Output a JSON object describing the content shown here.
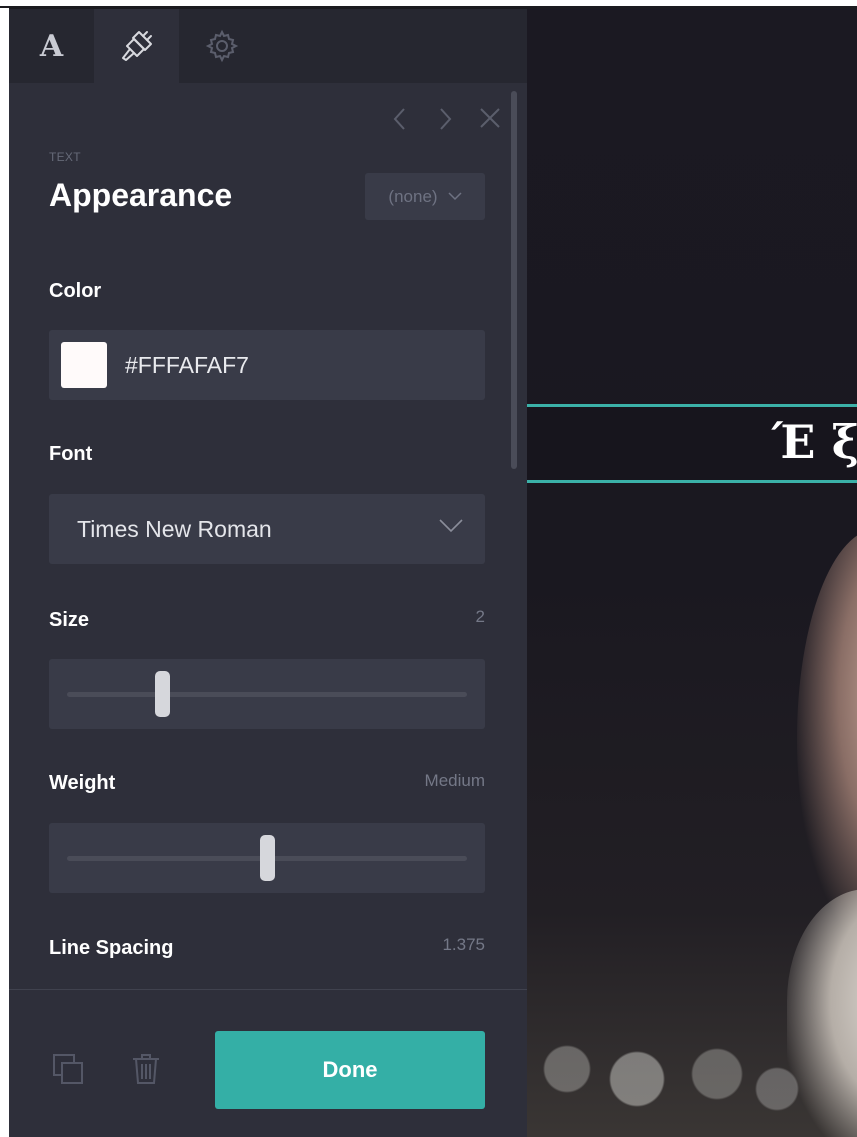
{
  "tabs": [
    {
      "name": "text-tab",
      "label": "A",
      "active": false
    },
    {
      "name": "style-tab",
      "icon": "paintbrush-icon",
      "active": true
    },
    {
      "name": "settings-tab",
      "icon": "gear-icon",
      "active": false
    }
  ],
  "panel": {
    "eyebrow": "TEXT",
    "title": "Appearance",
    "preset": "(none)"
  },
  "color": {
    "label": "Color",
    "hex": "#FFFAFAF7",
    "swatch": "#FFFAFA"
  },
  "font": {
    "label": "Font",
    "value": "Times New Roman"
  },
  "size": {
    "label": "Size",
    "value": "2",
    "fraction": 0.24
  },
  "weight": {
    "label": "Weight",
    "value": "Medium",
    "fraction": 0.5
  },
  "line_spacing": {
    "label": "Line Spacing",
    "value": "1.375"
  },
  "footer": {
    "done_label": "Done"
  },
  "canvas": {
    "text": "Έ ξ"
  },
  "colors": {
    "accent": "#34afa6",
    "panel_bg": "#2e2f3a",
    "field_bg": "#393b48"
  }
}
